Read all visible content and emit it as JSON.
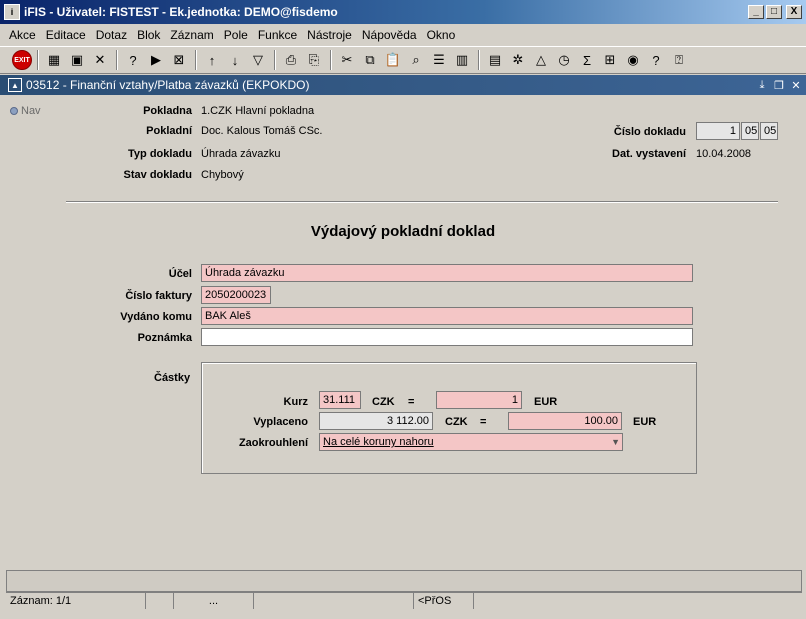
{
  "window": {
    "title": "iFIS - Uživatel: FISTEST - Ek.jednotka: DEMO@fisdemo",
    "minimize": "_",
    "maximize": "□",
    "close": "X"
  },
  "menu": [
    "Akce",
    "Editace",
    "Dotaz",
    "Blok",
    "Záznam",
    "Pole",
    "Funkce",
    "Nástroje",
    "Nápověda",
    "Okno"
  ],
  "toolbar": {
    "exit_label": "EXIT",
    "icons": [
      "insert-record-icon",
      "save-icon",
      "delete-record-icon",
      "enter-query-icon",
      "execute-query-icon",
      "cancel-query-icon",
      "sort-asc-icon",
      "sort-desc-icon",
      "filter-icon",
      "print-icon",
      "print-preview-icon",
      "cut-icon",
      "copy-icon",
      "paste-icon",
      "find-icon",
      "list-icon",
      "columns-icon",
      "calculator-icon",
      "tools-icon",
      "warning-icon",
      "clock-icon",
      "sum-icon",
      "excel-icon",
      "web-icon",
      "help-icon",
      "context-help-icon"
    ]
  },
  "form": {
    "title": "03512 - Finanční vztahy/Platba závazků (EKPOKDO)",
    "nav_label": "Nav",
    "header": {
      "pokladna_label": "Pokladna",
      "pokladna_value": "1.CZK Hlavní pokladna",
      "pokladni_label": "Pokladní",
      "pokladni_value": "Doc. Kalous Tomáš CSc.",
      "typ_label": "Typ dokladu",
      "typ_value": "Úhrada závazku",
      "stav_label": "Stav dokladu",
      "stav_value": "Chybový",
      "cislo_label": "Číslo dokladu",
      "cislo_1": "1",
      "cislo_2": "05",
      "cislo_3": "05",
      "dat_label": "Dat. vystavení",
      "dat_value": "10.04.2008"
    },
    "heading": "Výdajový pokladní doklad",
    "ucel_label": "Účel",
    "ucel_value": "Úhrada závazku",
    "faktura_label": "Číslo faktury",
    "faktura_value": "2050200023",
    "vydano_label": "Vydáno komu",
    "vydano_value": "BAK Aleš",
    "poznamka_label": "Poznámka",
    "poznamka_value": "",
    "castky": {
      "label": "Částky",
      "kurz_label": "Kurz",
      "kurz_value": "31.111",
      "czk1": "CZK",
      "eq1": "=",
      "eur_amount": "1",
      "eur1": "EUR",
      "vyplaceno_label": "Vyplaceno",
      "vyplaceno_czk": "3 112.00",
      "czk2": "CZK",
      "eq2": "=",
      "vyplaceno_eur": "100.00",
      "eur2": "EUR",
      "zaokr_label": "Zaokrouhlení",
      "zaokr_value": "Na celé koruny nahoru"
    }
  },
  "status": {
    "record": "Záznam: 1/1",
    "dots": "...",
    "mode": "<PřOS"
  }
}
